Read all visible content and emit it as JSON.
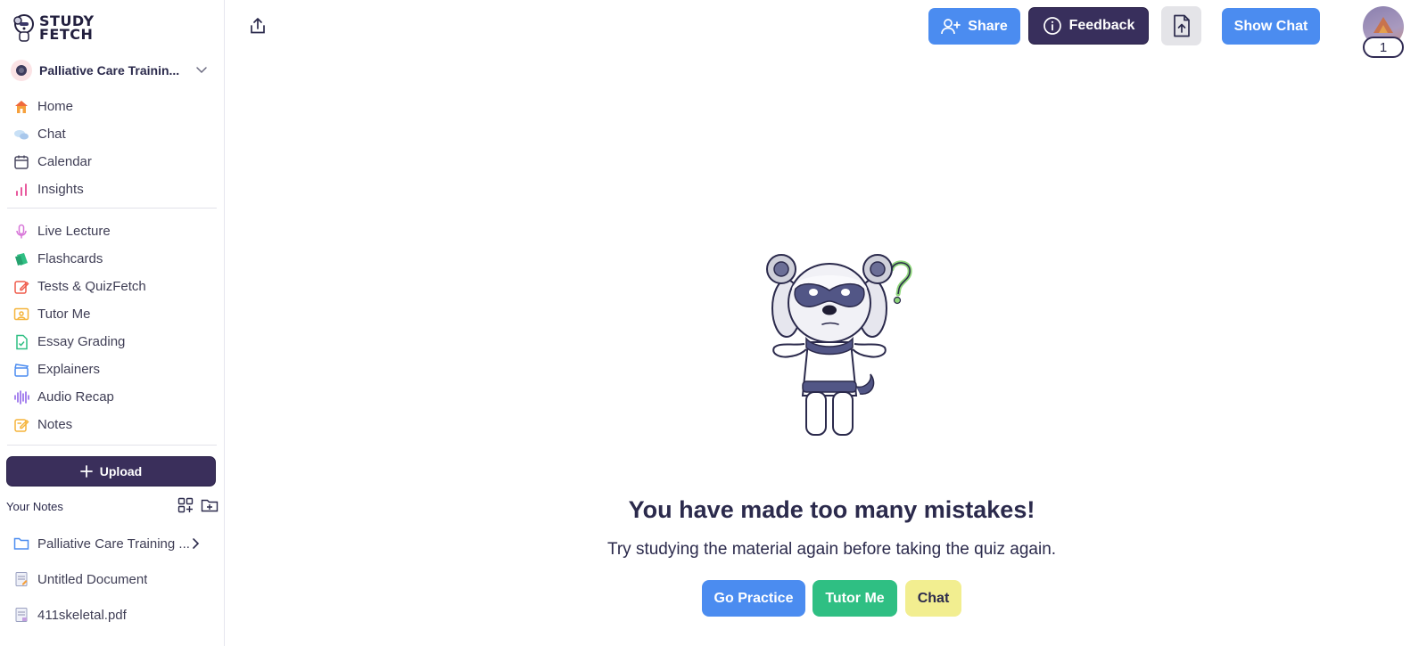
{
  "app": {
    "logo_line1": "STUDY",
    "logo_line2": "FETCH"
  },
  "sidebar": {
    "class_name": "Palliative Care Trainin...",
    "nav_primary": [
      {
        "label": "Home",
        "icon": "home-icon"
      },
      {
        "label": "Chat",
        "icon": "chat-bubbles-icon"
      },
      {
        "label": "Calendar",
        "icon": "calendar-icon"
      },
      {
        "label": "Insights",
        "icon": "bar-chart-icon"
      }
    ],
    "nav_tools": [
      {
        "label": "Live Lecture",
        "icon": "microphone-icon"
      },
      {
        "label": "Flashcards",
        "icon": "cards-icon"
      },
      {
        "label": "Tests & QuizFetch",
        "icon": "edit-pencil-icon"
      },
      {
        "label": "Tutor Me",
        "icon": "tutor-board-icon"
      },
      {
        "label": "Essay Grading",
        "icon": "graded-document-icon"
      },
      {
        "label": "Explainers",
        "icon": "clapperboard-icon"
      },
      {
        "label": "Audio Recap",
        "icon": "audio-wave-icon"
      },
      {
        "label": "Notes",
        "icon": "notes-icon"
      }
    ],
    "upload_label": "Upload",
    "notes_title": "Your Notes",
    "notes": [
      {
        "label": "Palliative Care Training ...",
        "icon": "folder-icon"
      },
      {
        "label": "Untitled Document",
        "icon": "document-icon"
      },
      {
        "label": "411skeletal.pdf",
        "icon": "pdf-file-icon"
      }
    ]
  },
  "header": {
    "share_label": "Share",
    "feedback_label": "Feedback",
    "show_chat_label": "Show Chat",
    "avatar_count": "1"
  },
  "main": {
    "headline": "You have made too many mistakes!",
    "subline": "Try studying the material again before taking the quiz again.",
    "go_practice_label": "Go Practice",
    "tutor_me_label": "Tutor Me",
    "chat_label": "Chat"
  },
  "colors": {
    "primary_blue": "#4b8cf0",
    "dark_purple": "#382f5c",
    "green": "#2fbf83",
    "yellow": "#f2ee90"
  }
}
